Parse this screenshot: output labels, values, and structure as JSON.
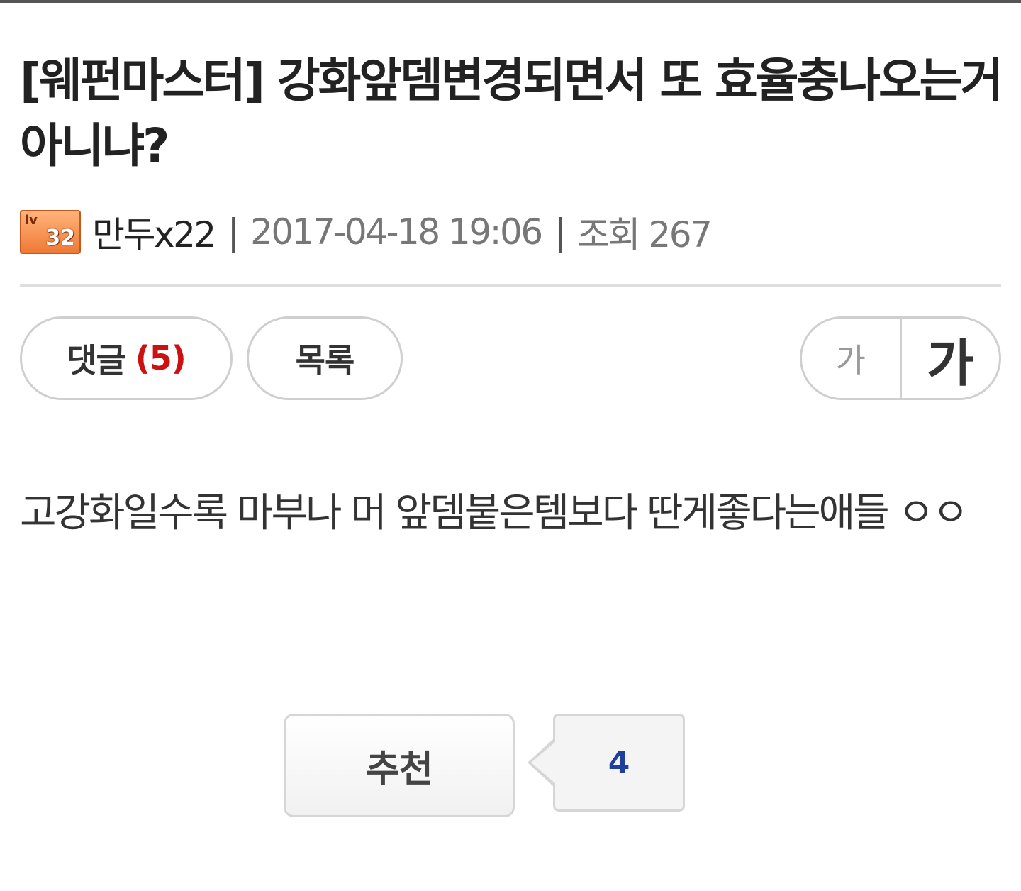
{
  "post": {
    "title": "[웨펀마스터] 강화앞뎀변경되면서 또 효율충나오는거아니냐?",
    "author": {
      "level_badge_text": "lv",
      "level": "32",
      "name": "만두x22"
    },
    "separator": "|",
    "date": "2017-04-18 19:06",
    "views_label": "조회",
    "views_count": "267",
    "body": "고강화일수록 마부나 머 앞뎀붙은템보다 딴게좋다는애들 ㅇㅇ"
  },
  "actions": {
    "comments_label": "댓글",
    "comments_count": "(5)",
    "list_label": "목록",
    "font_small_label": "가",
    "font_large_label": "가"
  },
  "recommend": {
    "label": "추천",
    "count": "4"
  },
  "colors": {
    "comment_count": "#cc1111",
    "recommend_count": "#1f3f9a",
    "badge": "#ef7a36"
  }
}
